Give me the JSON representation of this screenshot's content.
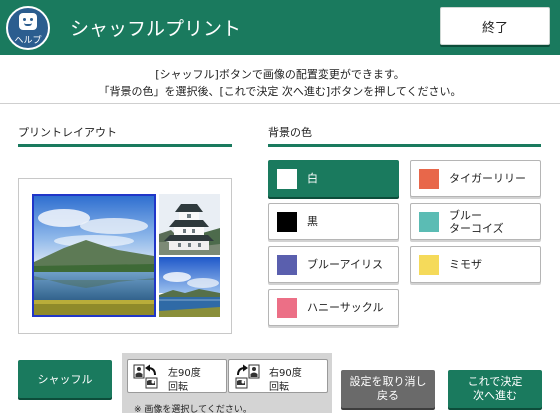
{
  "header": {
    "help_label": "ヘルプ",
    "title": "シャッフルプリント",
    "end_label": "終了"
  },
  "instructions": {
    "line1": "[シャッフル]ボタンで画像の配置変更ができます。",
    "line2": "「背景の色」を選択後、[これで決定 次へ進む]ボタンを押してください。"
  },
  "layout_section": {
    "title": "プリントレイアウト"
  },
  "background_section": {
    "title": "背景の色",
    "selected": "白",
    "colors": [
      {
        "label": "白",
        "swatch": "#ffffff"
      },
      {
        "label": "タイガーリリー",
        "swatch": "#e8674a"
      },
      {
        "label": "黒",
        "swatch": "#000000"
      },
      {
        "label_line1": "ブルー",
        "label_line2": "ターコイズ",
        "swatch": "#5bbcb4"
      },
      {
        "label": "ブルーアイリス",
        "swatch": "#5a5fae"
      },
      {
        "label": "ミモザ",
        "swatch": "#f5da5a"
      },
      {
        "label": "ハニーサックル",
        "swatch": "#ec6f86"
      }
    ]
  },
  "controls": {
    "shuffle_label": "シャッフル",
    "rotate_left": {
      "line1": "左90度",
      "line2": "回転"
    },
    "rotate_right": {
      "line1": "右90度",
      "line2": "回転"
    },
    "note": "※ 画像を選択してください。",
    "cancel_line1": "設定を取り消し",
    "cancel_line2": "戻る",
    "confirm_line1": "これで決定",
    "confirm_line2": "次へ進む"
  },
  "colors": {
    "brand_green": "#1a7a5e",
    "selection_blue": "#2036c8"
  }
}
